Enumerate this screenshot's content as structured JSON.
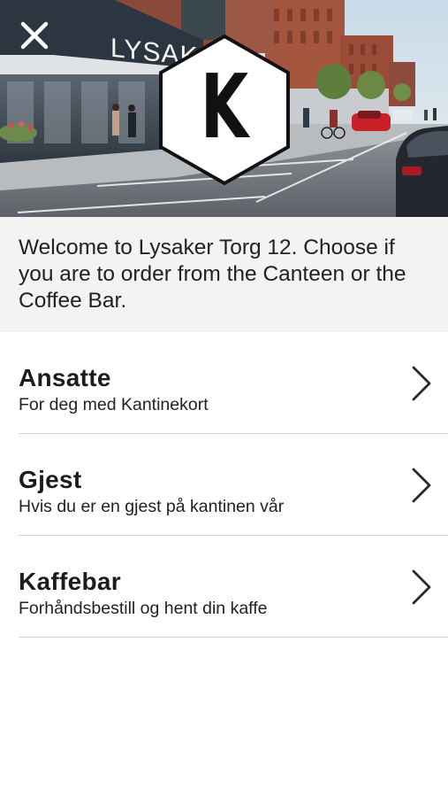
{
  "hero": {
    "building_sign": "LYSAKE",
    "logo_letter": "K"
  },
  "welcome": {
    "text": "Welcome to Lysaker Torg 12. Choose if you are to order from the Canteen or the Coffee Bar."
  },
  "menu": {
    "items": [
      {
        "title": "Ansatte",
        "subtitle": "For deg med Kantinekort"
      },
      {
        "title": "Gjest",
        "subtitle": "Hvis du er en gjest på kantinen vår"
      },
      {
        "title": "Kaffebar",
        "subtitle": "Forhåndsbestill og hent din kaffe"
      }
    ]
  },
  "colors": {
    "welcome_background": "#f3f3f3",
    "divider": "#d4d4d4",
    "chevron": "#2a2a2a"
  },
  "icons": {
    "close": "close-icon",
    "chevron": "chevron-right-icon",
    "logo": "hexagon-k-logo"
  }
}
